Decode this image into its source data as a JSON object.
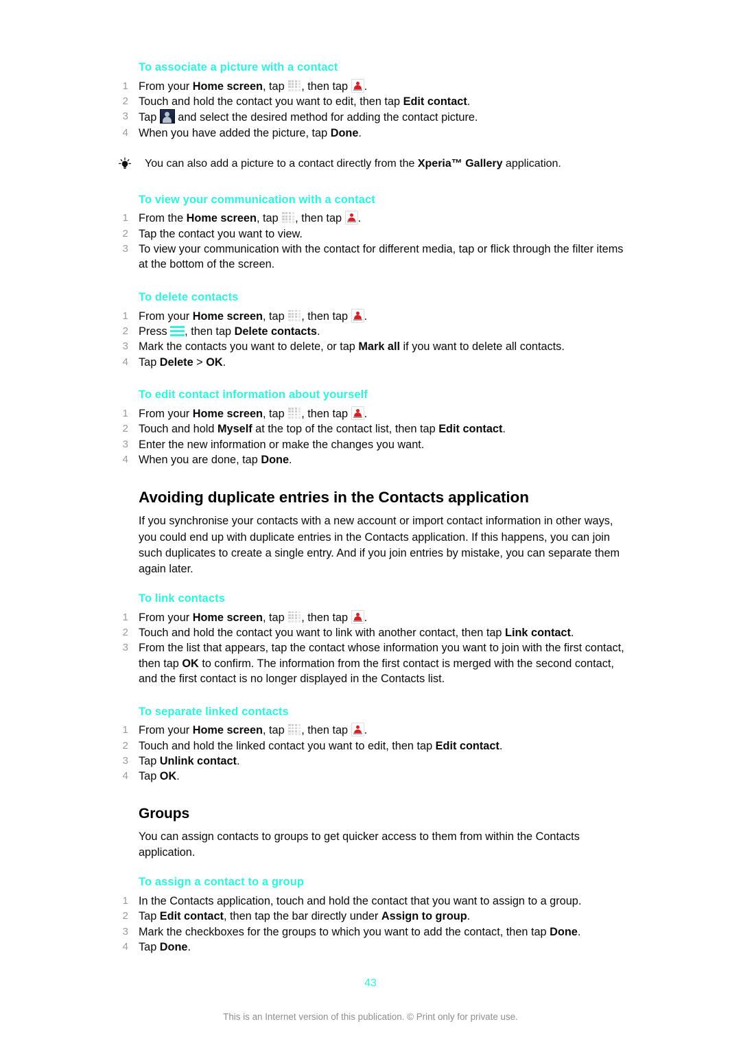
{
  "document": {
    "page_number": "43",
    "footer_note": "This is an Internet version of this publication. © Print only for private use.",
    "accent_color": "#2ff3de"
  },
  "sections": {
    "associate_picture": {
      "heading": "To associate a picture with a contact",
      "steps": [
        {
          "num": "1",
          "prefix": "From your ",
          "bold1": "Home screen",
          "mid": ", tap ",
          "icon1": "grid-icon",
          "mid2": ", then tap ",
          "icon2": "contacts-icon",
          "suffix": "."
        },
        {
          "num": "2",
          "text_before": "Touch and hold the contact you want to edit, then tap ",
          "bold": "Edit contact",
          "text_after": "."
        },
        {
          "num": "3",
          "text_before": "Tap ",
          "icon": "avatar-icon",
          "text_after": " and select the desired method for adding the contact picture."
        },
        {
          "num": "4",
          "text_before": "When you have added the picture, tap ",
          "bold": "Done",
          "text_after": "."
        }
      ],
      "tip": {
        "icon": "lightbulb-icon",
        "text_before": "You can also add a picture to a contact directly from the ",
        "bold": "Xperia™ Gallery",
        "text_after": " application."
      }
    },
    "view_communication": {
      "heading": "To view your communication with a contact",
      "steps": [
        {
          "num": "1",
          "prefix": "From the ",
          "bold1": "Home screen",
          "mid": ", tap ",
          "icon1": "grid-icon",
          "mid2": ", then tap ",
          "icon2": "contacts-icon",
          "suffix": "."
        },
        {
          "num": "2",
          "text": "Tap the contact you want to view."
        },
        {
          "num": "3",
          "text": "To view your communication with the contact for different media, tap or flick through the filter items at the bottom of the screen."
        }
      ]
    },
    "delete_contacts": {
      "heading": "To delete contacts",
      "steps": [
        {
          "num": "1",
          "prefix": "From your ",
          "bold1": "Home screen",
          "mid": ", tap ",
          "icon1": "grid-icon",
          "mid2": ", then tap ",
          "icon2": "contacts-icon",
          "suffix": "."
        },
        {
          "num": "2",
          "text_before": "Press ",
          "icon": "menu-icon",
          "text_mid": ", then tap ",
          "bold": "Delete contacts",
          "text_after": "."
        },
        {
          "num": "3",
          "text_before": "Mark the contacts you want to delete, or tap ",
          "bold": "Mark all",
          "text_after": " if you want to delete all contacts."
        },
        {
          "num": "4",
          "text_before": "Tap ",
          "bold": "Delete",
          "text_mid": " > ",
          "bold2": "OK",
          "text_after": "."
        }
      ]
    },
    "edit_own_info": {
      "heading": "To edit contact information about yourself",
      "steps": [
        {
          "num": "1",
          "prefix": "From your ",
          "bold1": "Home screen",
          "mid": ", tap ",
          "icon1": "grid-icon",
          "mid2": ", then tap ",
          "icon2": "contacts-icon",
          "suffix": "."
        },
        {
          "num": "2",
          "text_before": "Touch and hold ",
          "bold": "Myself",
          "text_mid": " at the top of the contact list, then tap ",
          "bold2": "Edit contact",
          "text_after": "."
        },
        {
          "num": "3",
          "text": "Enter the new information or make the changes you want."
        },
        {
          "num": "4",
          "text_before": "When you are done, tap ",
          "bold": "Done",
          "text_after": "."
        }
      ]
    },
    "avoiding_duplicates": {
      "heading": "Avoiding duplicate entries in the Contacts application",
      "paragraph": "If you synchronise your contacts with a new account or import contact information in other ways, you could end up with duplicate entries in the Contacts application. If this happens, you can join such duplicates to create a single entry. And if you join entries by mistake, you can separate them again later."
    },
    "link_contacts": {
      "heading": "To link contacts",
      "steps": [
        {
          "num": "1",
          "prefix": "From your ",
          "bold1": "Home screen",
          "mid": ", tap ",
          "icon1": "grid-icon",
          "mid2": ", then tap ",
          "icon2": "contacts-icon",
          "suffix": "."
        },
        {
          "num": "2",
          "text_before": "Touch and hold the contact you want to link with another contact, then tap ",
          "bold": "Link contact",
          "text_after": "."
        },
        {
          "num": "3",
          "text_before": "From the list that appears, tap the contact whose information you want to join with the first contact, then tap ",
          "bold": "OK",
          "text_after": " to confirm. The information from the first contact is merged with the second contact, and the first contact is no longer displayed in the Contacts list."
        }
      ]
    },
    "separate_linked": {
      "heading": "To separate linked contacts",
      "steps": [
        {
          "num": "1",
          "prefix": "From your ",
          "bold1": "Home screen",
          "mid": ", tap ",
          "icon1": "grid-icon",
          "mid2": ", then tap ",
          "icon2": "contacts-icon",
          "suffix": "."
        },
        {
          "num": "2",
          "text_before": "Touch and hold the linked contact you want to edit, then tap ",
          "bold": "Edit contact",
          "text_after": "."
        },
        {
          "num": "3",
          "text_before": "Tap ",
          "bold": "Unlink contact",
          "text_after": "."
        },
        {
          "num": "4",
          "text_before": "Tap ",
          "bold": "OK",
          "text_after": "."
        }
      ]
    },
    "groups": {
      "heading": "Groups",
      "paragraph": "You can assign contacts to groups to get quicker access to them from within the Contacts application."
    },
    "assign_group": {
      "heading": "To assign a contact to a group",
      "steps": [
        {
          "num": "1",
          "text": "In the Contacts application, touch and hold the contact that you want to assign to a group."
        },
        {
          "num": "2",
          "text_before": "Tap ",
          "bold": "Edit contact",
          "text_mid": ", then tap the bar directly under ",
          "bold2": "Assign to group",
          "text_after": "."
        },
        {
          "num": "3",
          "text_before": "Mark the checkboxes for the groups to which you want to add the contact, then tap ",
          "bold": "Done",
          "text_after": "."
        },
        {
          "num": "4",
          "text_before": "Tap ",
          "bold": "Done",
          "text_after": "."
        }
      ]
    }
  }
}
